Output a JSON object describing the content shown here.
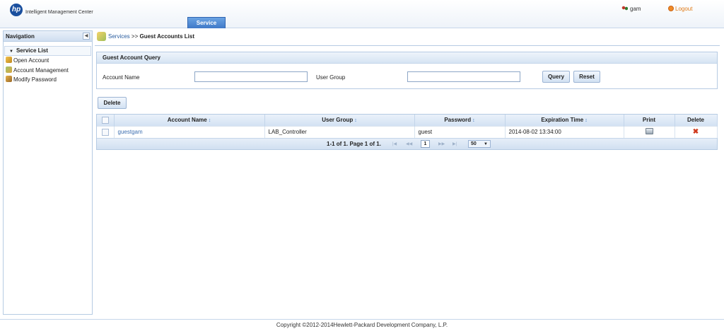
{
  "header": {
    "logo_text": "hp",
    "product_name": "Intelligent Management Center",
    "tab_label": "Service",
    "user_name": "gam",
    "logout_label": "Logout"
  },
  "navigation": {
    "title": "Navigation",
    "section_title": "Service List",
    "items": [
      {
        "label": "Open Account",
        "icon": "key-user-icon"
      },
      {
        "label": "Account Management",
        "icon": "account-icon"
      },
      {
        "label": "Modify Password",
        "icon": "password-icon"
      }
    ]
  },
  "breadcrumb": {
    "link": "Services",
    "separator": ">>",
    "current": "Guest Accounts List"
  },
  "query": {
    "title": "Guest Account Query",
    "account_name_label": "Account Name",
    "account_name_value": "",
    "user_group_label": "User Group",
    "user_group_value": "",
    "query_button": "Query",
    "reset_button": "Reset"
  },
  "toolbar": {
    "delete_button": "Delete"
  },
  "table": {
    "columns": [
      "Account Name",
      "User Group",
      "Password",
      "Expiration Time",
      "Print",
      "Delete"
    ],
    "sort_icon": "↕",
    "rows": [
      {
        "account_name": "guestgam",
        "user_group": "LAB_Controller",
        "password": "guest",
        "expiration_time": "2014-08-02 13:34:00"
      }
    ]
  },
  "pager": {
    "summary": "1-1 of 1. Page 1 of 1.",
    "current_page": "1",
    "page_size": "50"
  },
  "footer": {
    "copyright": "Copyright ©2012-2014Hewlett-Packard Development Company, L.P."
  },
  "colors": {
    "accent": "#3f79c8",
    "link": "#2a5d9f",
    "border": "#b6cbe3",
    "delete": "#d03a1e",
    "logout": "#e07b18"
  }
}
